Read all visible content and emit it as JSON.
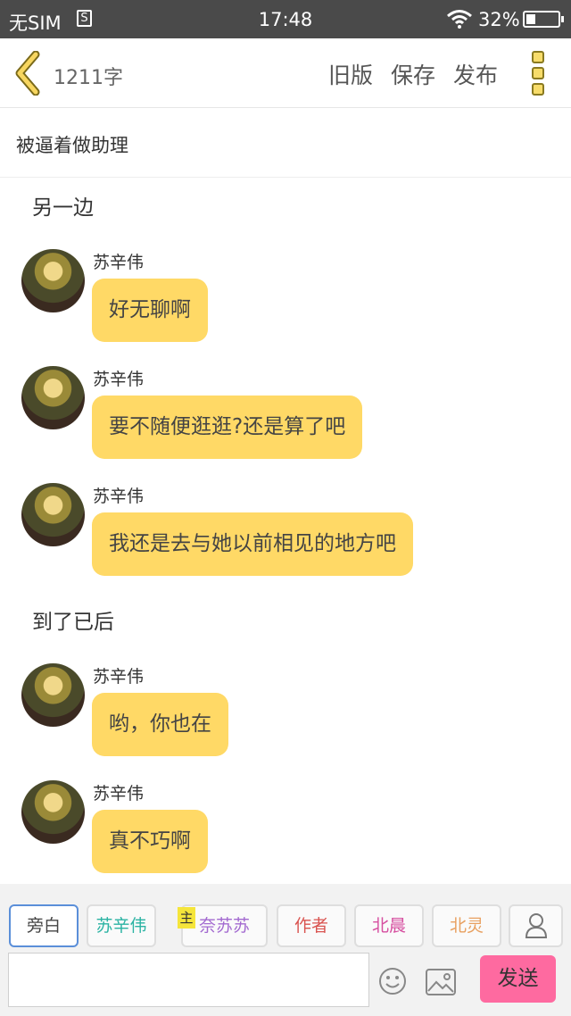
{
  "status_bar": {
    "carrier": "无SIM",
    "s_icon": "S",
    "time": "17:48",
    "battery": "32%"
  },
  "toolbar": {
    "word_count": "1211字",
    "old_version": "旧版",
    "save": "保存",
    "publish": "发布"
  },
  "chapter": {
    "title": "被逼着做助理"
  },
  "content": {
    "narration_1": "另一边",
    "narration_2": "到了已后",
    "messages": [
      {
        "name": "苏辛伟",
        "text": "好无聊啊"
      },
      {
        "name": "苏辛伟",
        "text": "要不随便逛逛?还是算了吧"
      },
      {
        "name": "苏辛伟",
        "text": "我还是去与她以前相见的地方吧"
      },
      {
        "name": "苏辛伟",
        "text": "哟，你也在"
      },
      {
        "name": "苏辛伟",
        "text": "真不巧啊"
      }
    ]
  },
  "roles": [
    {
      "label": "旁白",
      "color": "#444444"
    },
    {
      "label": "苏辛伟",
      "color": "#2bb3a3"
    },
    {
      "label": "奈苏苏",
      "color": "#a36ad0"
    },
    {
      "label": "作者",
      "color": "#d9534f"
    },
    {
      "label": "北晨",
      "color": "#d64fa0"
    },
    {
      "label": "北灵",
      "color": "#e8a060"
    }
  ],
  "main_tag": "主",
  "composer": {
    "send": "发送"
  }
}
